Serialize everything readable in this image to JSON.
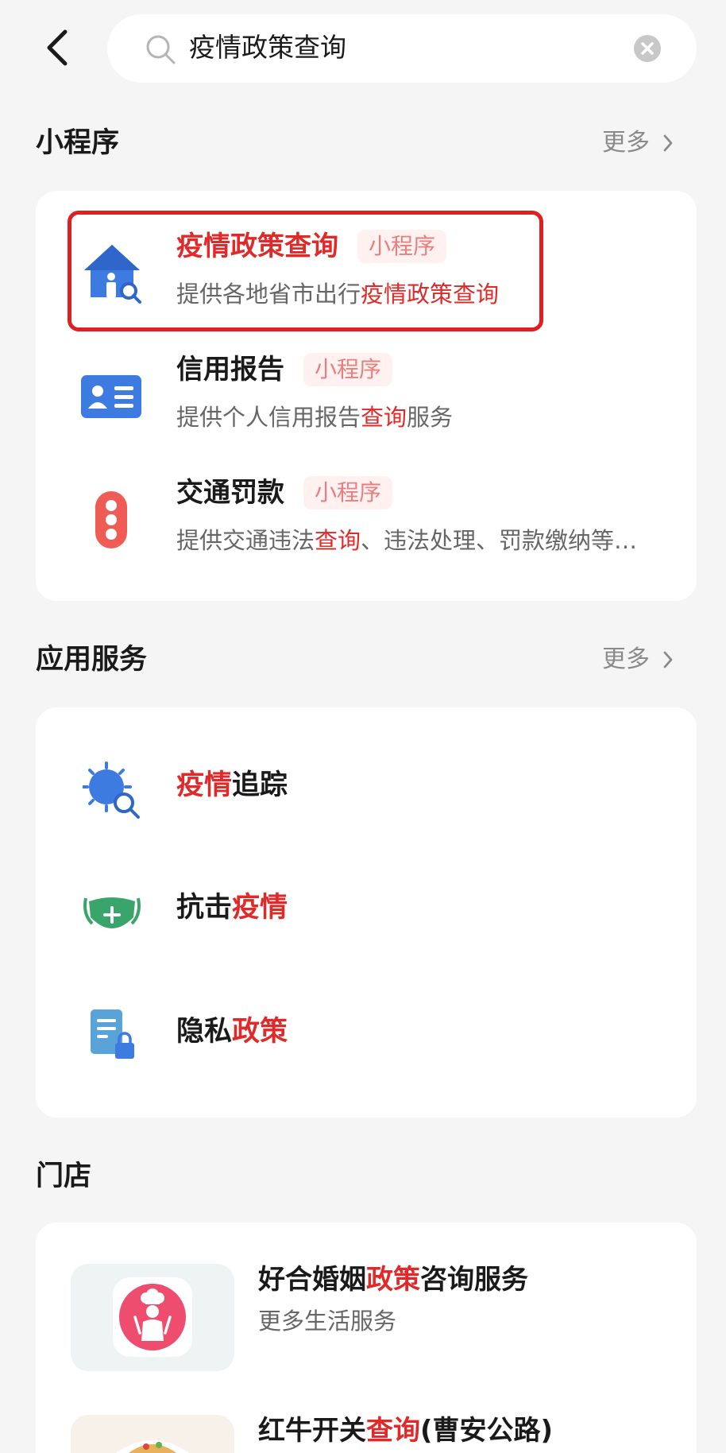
{
  "search": {
    "query": "疫情政策查询"
  },
  "sections": {
    "mini_programs": {
      "title": "小程序",
      "more": "更多"
    },
    "services": {
      "title": "应用服务",
      "more": "更多"
    },
    "stores": {
      "title": "门店"
    }
  },
  "mini_programs": [
    {
      "name": "疫情政策查询",
      "tag": "小程序",
      "desc_prefix": "提供各地省市出行",
      "desc_highlight": "疫情政策查询",
      "desc_suffix": "",
      "icon": "house-search-icon"
    },
    {
      "name": "信用报告",
      "tag": "小程序",
      "desc_prefix": "提供个人信用报告",
      "desc_highlight": "查询",
      "desc_suffix": "服务",
      "icon": "id-card-icon"
    },
    {
      "name": "交通罚款",
      "tag": "小程序",
      "desc_prefix": "提供交通违法",
      "desc_highlight": "查询",
      "desc_suffix": "、违法处理、罚款缴纳等…",
      "icon": "traffic-light-icon"
    }
  ],
  "services": [
    {
      "highlight_first": true,
      "part1": "疫情",
      "part2": "追踪",
      "icon": "virus-search-icon"
    },
    {
      "highlight_first": false,
      "part1": "抗击",
      "part2": "疫情",
      "icon": "mask-icon"
    },
    {
      "highlight_first": false,
      "part1": "隐私",
      "part2": "政策",
      "icon": "document-lock-icon"
    }
  ],
  "stores": [
    {
      "name_prefix": "好合婚姻",
      "name_highlight": "政策",
      "name_suffix": "咨询服务",
      "sub": "更多生活服务",
      "icon": "chef-icon"
    },
    {
      "name_prefix": "红牛开关",
      "name_highlight": "查询",
      "name_suffix": "(曹安公路)",
      "sub": "",
      "icon": "food-icon"
    }
  ],
  "colors": {
    "accent_red": "#e02a2a",
    "tag_text": "#e87f7f",
    "tag_bg": "#fff1f0",
    "background": "#f5f5f5"
  }
}
